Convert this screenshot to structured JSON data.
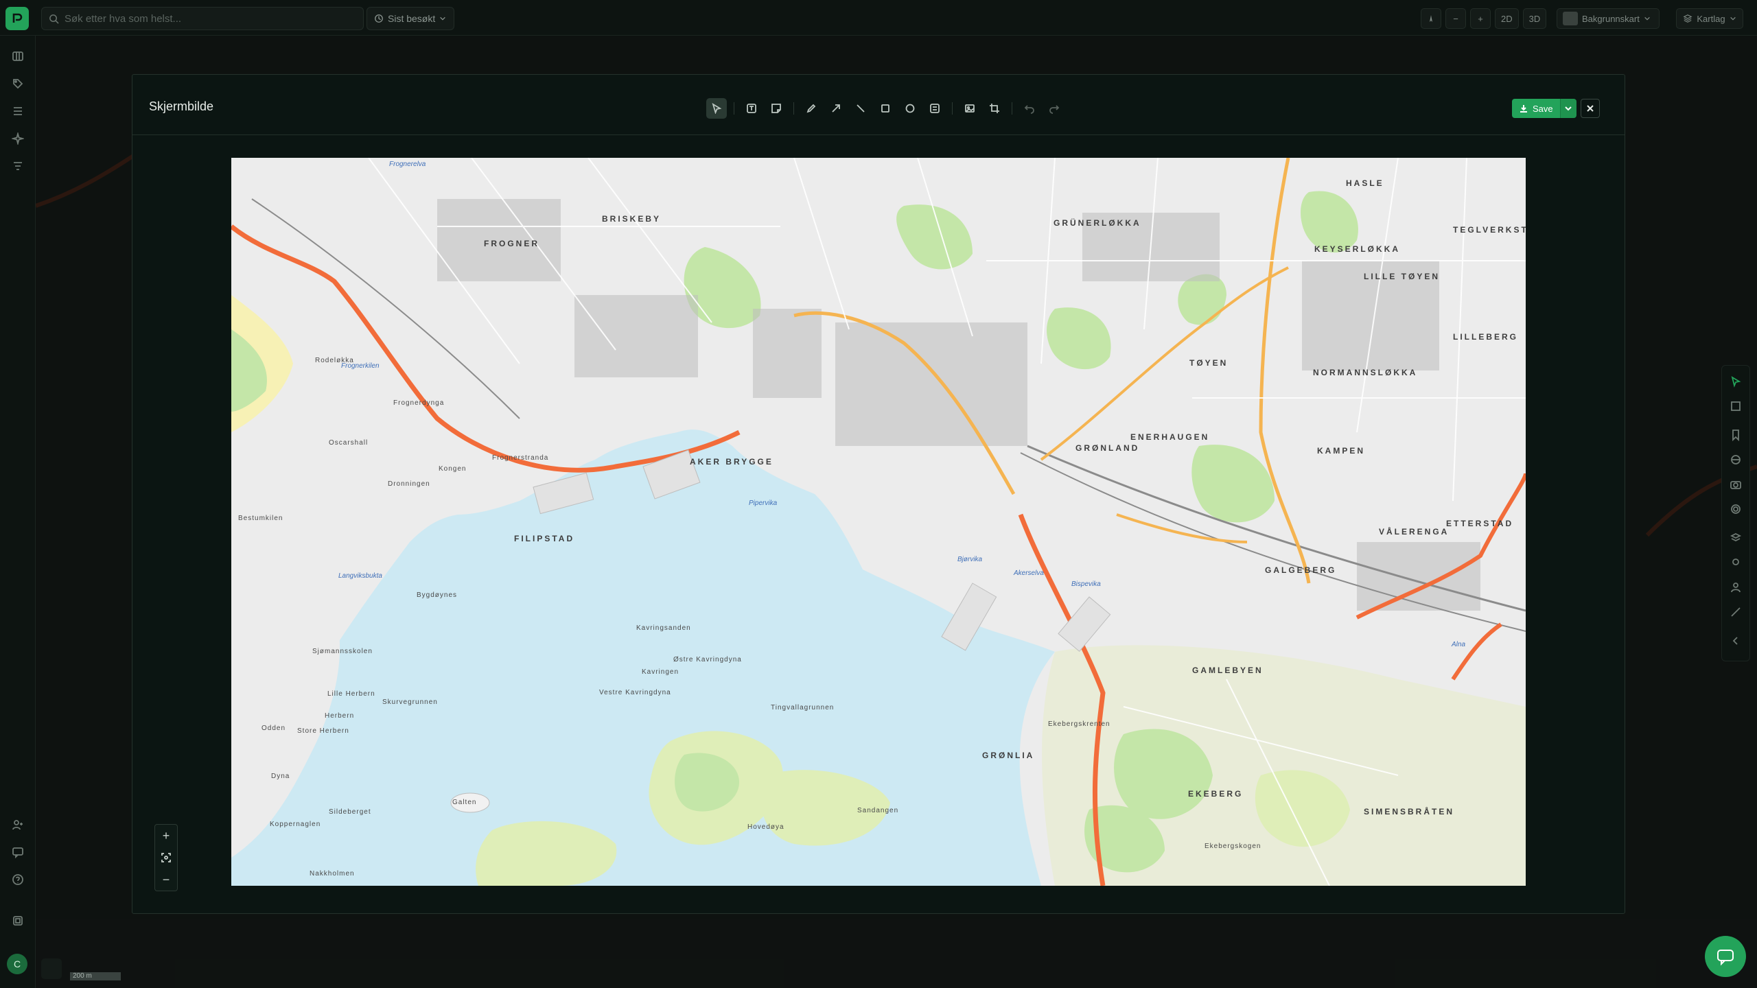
{
  "app": {
    "search_placeholder": "Søk etter hva som helst...",
    "recent_label": "Sist besøkt",
    "view_2d": "2D",
    "view_3d": "3D",
    "basemap_label": "Bakgrunnskart",
    "layers_label": "Kartlag",
    "user_initial": "C",
    "scale_text": "200 m"
  },
  "modal": {
    "title": "Skjermbilde",
    "save_label": "Save"
  },
  "map_labels": {
    "areas": [
      "BRISKEBY",
      "FROGNER",
      "GRÜNERLØKKA",
      "HASLE",
      "KEYSERLØKKA",
      "LILLE TØYEN",
      "TEGLVERKST",
      "LILLEBERG",
      "TØYEN",
      "NORMANNSLØKKA",
      "AKER BRYGGE",
      "FILIPSTAD",
      "GRØNLAND",
      "ENERHAUGEN",
      "KAMPEN",
      "ETTERSTAD",
      "VÅLERENGA",
      "GAMLEBYEN",
      "GALGEBERG",
      "GRØNLIA",
      "EKEBERG",
      "SIMENSBRÅTEN"
    ],
    "water": [
      "Frognerelva",
      "Frognerkilen",
      "Langviksbukta",
      "Pipervika",
      "Bjørvika",
      "Akerselva",
      "Alna",
      "Bispevika"
    ],
    "places": [
      "Frognerstranda",
      "Kongen",
      "Dronningen",
      "Bygdøynes",
      "Kavringsanden",
      "Kavringen",
      "Østre Kavringdyna",
      "Vestre Kavringdyna",
      "Tingvallagrunnen",
      "Hovedøya",
      "Sandangen",
      "Galten",
      "Lille Herbern",
      "Herbern",
      "Skurvegrunnen",
      "Store Herbern",
      "Odden",
      "Dyna",
      "Sildeberget",
      "Koppernaglen",
      "Nakkholmen",
      "Rodeløkka",
      "Frognerdynga",
      "Oscarshall",
      "Bestumkilen",
      "Sjømannsskolen",
      "Ekebergskrenten",
      "Ekebergskogen"
    ]
  },
  "colors": {
    "accent": "#23a35a",
    "water": "#cde9f3",
    "park": "#c4e6a8",
    "road_major": "#f26c3a",
    "road_minor": "#f5b451"
  },
  "icons": {
    "toolbar": [
      "pointer-icon",
      "text-icon",
      "sticky-note-icon",
      "pencil-icon",
      "arrow-icon",
      "line-icon",
      "rectangle-icon",
      "circle-icon",
      "numbered-list-icon",
      "image-icon",
      "crop-icon",
      "undo-icon",
      "redo-icon"
    ]
  }
}
